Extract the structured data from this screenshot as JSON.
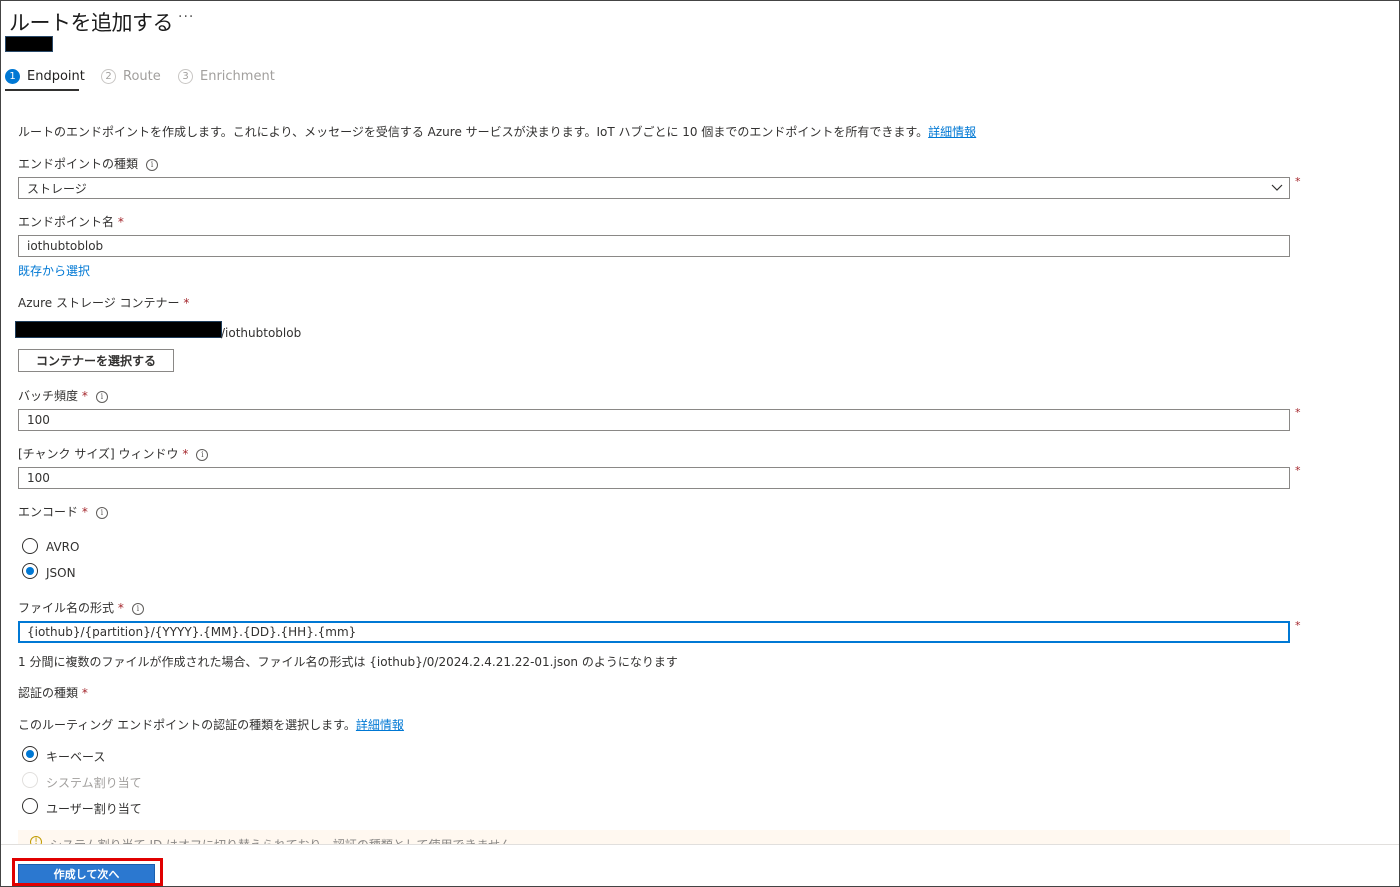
{
  "header": {
    "title": "ルートを追加する",
    "more_label": "···"
  },
  "tabs": [
    {
      "num": "1",
      "label": "Endpoint"
    },
    {
      "num": "2",
      "label": "Route"
    },
    {
      "num": "3",
      "label": "Enrichment"
    }
  ],
  "intro": {
    "text": "ルートのエンドポイントを作成します。これにより、メッセージを受信する Azure サービスが決まります。IoT ハブごとに 10 個までのエンドポイントを所有できます。",
    "link": "詳細情報"
  },
  "endpoint_type": {
    "label": "エンドポイントの種類",
    "value": "ストレージ"
  },
  "endpoint_name": {
    "label": "エンドポイント名",
    "value": "iothubtoblob",
    "select_existing": "既存から選択"
  },
  "container": {
    "label": "Azure ストレージ コンテナー",
    "path_suffix": "/iothubtoblob",
    "button": "コンテナーを選択する"
  },
  "batch_frequency": {
    "label": "バッチ頻度",
    "value": "100"
  },
  "chunk_size": {
    "label": "[チャンク サイズ] ウィンドウ",
    "value": "100"
  },
  "encoding": {
    "label": "エンコード",
    "options": [
      "AVRO",
      "JSON"
    ],
    "selected": "JSON"
  },
  "file_name_format": {
    "label": "ファイル名の形式",
    "value": "{iothub}/{partition}/{YYYY}.{MM}.{DD}.{HH}.{mm}",
    "hint": "1 分間に複数のファイルが作成された場合、ファイル名の形式は {iothub}/0/2024.2.4.21.22-01.json のようになります"
  },
  "auth": {
    "label": "認証の種類",
    "desc": "このルーティング エンドポイントの認証の種類を選択します。",
    "link": "詳細情報",
    "options": [
      "キーベース",
      "システム割り当て",
      "ユーザー割り当て"
    ],
    "selected": "キーベース"
  },
  "warning": {
    "text": "システム割り当て ID はオフに切り替えられており、認証の種類として使用できません"
  },
  "required_mark": "*",
  "footer": {
    "primary_button": "作成して次へ"
  },
  "colors": {
    "accent": "#0078d4",
    "required": "#a4262c",
    "highlight_box": "#e00000"
  }
}
